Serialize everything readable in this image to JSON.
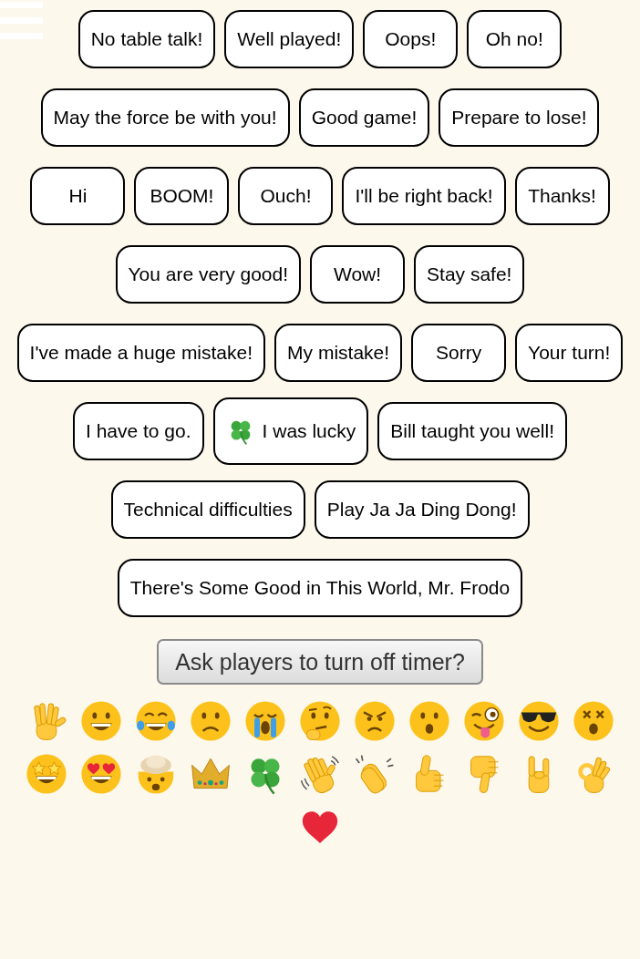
{
  "phrases": [
    {
      "label": "No table talk!",
      "kind": "plain"
    },
    {
      "label": "Well played!",
      "kind": "plain"
    },
    {
      "label": "Oops!",
      "kind": "plain"
    },
    {
      "label": "Oh no!",
      "kind": "plain"
    },
    {
      "label": "May the force be with you!",
      "kind": "plain"
    },
    {
      "label": "Good game!",
      "kind": "plain"
    },
    {
      "label": "Prepare to lose!",
      "kind": "plain"
    },
    {
      "label": "Hi",
      "kind": "plain"
    },
    {
      "label": "BOOM!",
      "kind": "plain"
    },
    {
      "label": "Ouch!",
      "kind": "plain"
    },
    {
      "label": "I'll be right back!",
      "kind": "plain"
    },
    {
      "label": "Thanks!",
      "kind": "plain"
    },
    {
      "label": "You are very good!",
      "kind": "plain"
    },
    {
      "label": "Wow!",
      "kind": "plain"
    },
    {
      "label": "Stay safe!",
      "kind": "plain"
    },
    {
      "label": "I've made a huge mistake!",
      "kind": "plain"
    },
    {
      "label": "My mistake!",
      "kind": "plain"
    },
    {
      "label": "Sorry",
      "kind": "plain"
    },
    {
      "label": "Your turn!",
      "kind": "plain"
    },
    {
      "label": "I have to go.",
      "kind": "plain"
    },
    {
      "label": "I was lucky",
      "kind": "clover"
    },
    {
      "label": "Bill taught you well!",
      "kind": "plain"
    },
    {
      "label": "Technical difficulties",
      "kind": "plain"
    },
    {
      "label": "Play Ja Ja Ding Dong!",
      "kind": "plain"
    },
    {
      "label": "There's Some Good in This World, Mr. Frodo",
      "kind": "plain"
    }
  ],
  "timer_button": {
    "label": "Ask players to turn off timer?"
  },
  "emojis": [
    {
      "kind": "vulcan"
    },
    {
      "kind": "grinning"
    },
    {
      "kind": "tears-of-joy"
    },
    {
      "kind": "frowning"
    },
    {
      "kind": "crying"
    },
    {
      "kind": "thinking"
    },
    {
      "kind": "angry"
    },
    {
      "kind": "surprised"
    },
    {
      "kind": "winking-tongue"
    },
    {
      "kind": "sunglasses"
    },
    {
      "kind": "dizzy"
    },
    {
      "kind": "star-struck"
    },
    {
      "kind": "heart-eyes"
    },
    {
      "kind": "exploding"
    },
    {
      "kind": "crown"
    },
    {
      "kind": "clover"
    },
    {
      "kind": "waving"
    },
    {
      "kind": "clapping"
    },
    {
      "kind": "thumbs-up"
    },
    {
      "kind": "thumbs-down"
    },
    {
      "kind": "rock-on"
    },
    {
      "kind": "ok-hand"
    },
    {
      "kind": "heart"
    }
  ]
}
